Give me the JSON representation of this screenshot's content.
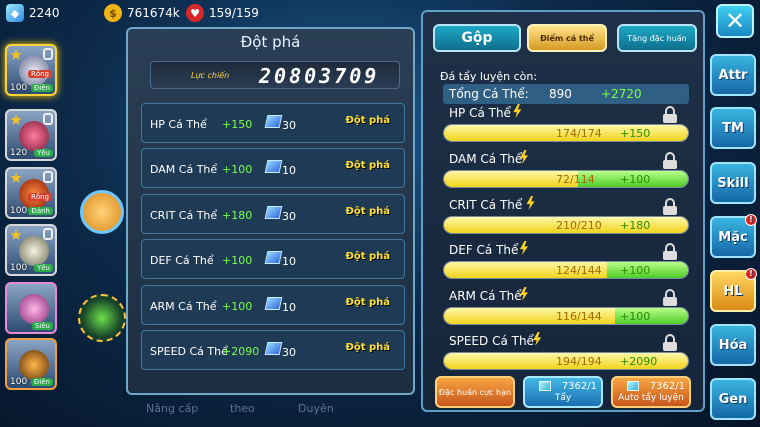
{
  "resources": {
    "gems": "2240",
    "gold": "761674k",
    "energy": "159/159"
  },
  "pets": [
    {
      "level": "100",
      "tag": "Điên",
      "type": "Rồng",
      "selected": true
    },
    {
      "level": "120",
      "tag": "Yếu",
      "type": "",
      "selected": false
    },
    {
      "level": "100",
      "tag": "Đánh",
      "type": "Rồng",
      "selected": false
    },
    {
      "level": "100",
      "tag": "Yếu",
      "type": "",
      "selected": false
    },
    {
      "level": "",
      "tag": "Siêu",
      "type": "",
      "selected": false
    },
    {
      "level": "100",
      "tag": "Điên",
      "type": "",
      "selected": false
    }
  ],
  "breakthrough": {
    "title": "Đột phá",
    "power_label": "Lực chiến",
    "power_value": "20803709",
    "rows": [
      {
        "name": "HP Cá Thể",
        "bonus": "+150",
        "cost": "30",
        "button": "Đột phá"
      },
      {
        "name": "DAM Cá Thể",
        "bonus": "+100",
        "cost": "10",
        "button": "Đột phá"
      },
      {
        "name": "CRIT Cá Thể",
        "bonus": "+180",
        "cost": "30",
        "button": "Đột phá"
      },
      {
        "name": "DEF Cá Thể",
        "bonus": "+100",
        "cost": "10",
        "button": "Đột phá"
      },
      {
        "name": "ARM Cá Thể",
        "bonus": "+100",
        "cost": "10",
        "button": "Đột phá"
      },
      {
        "name": "SPEED Cá Thể",
        "bonus": "+2090",
        "cost": "30",
        "button": "Đột phá"
      }
    ]
  },
  "background_tabs": [
    "Nâng cấp",
    "theo",
    "Duyên"
  ],
  "right_panel": {
    "tabs": [
      "Gộp",
      "Điểm cá thể",
      "Tăng đặc huấn"
    ],
    "remaining_label": "Đá tẩy luyện còn:",
    "total": {
      "label": "Tổng Cá Thể:",
      "value": "890",
      "delta": "+2720"
    },
    "stats": [
      {
        "name": "HP Cá Thể",
        "value": "174/174",
        "bonus": "+150",
        "fill": 1.0,
        "green": 0.0
      },
      {
        "name": "DAM Cá Thể",
        "value": "72/114",
        "bonus": "+100",
        "fill": 0.55,
        "green": 0.45
      },
      {
        "name": "CRIT Cá Thể",
        "value": "210/210",
        "bonus": "+180",
        "fill": 1.0,
        "green": 0.0
      },
      {
        "name": "DEF Cá Thể",
        "value": "124/144",
        "bonus": "+100",
        "fill": 0.67,
        "green": 0.33
      },
      {
        "name": "ARM Cá Thể",
        "value": "116/144",
        "bonus": "+100",
        "fill": 0.7,
        "green": 0.3
      },
      {
        "name": "SPEED Cá Thể",
        "value": "194/194",
        "bonus": "+2090",
        "fill": 1.0,
        "green": 0.0
      }
    ],
    "buttons": {
      "special": "Đặc huấn cực hạn",
      "wash_count": "7362/1",
      "wash_label": "Tẩy",
      "auto_count": "7362/1",
      "auto_label": "Auto tẩy luyện"
    }
  },
  "side_tabs": [
    {
      "label": "Attr",
      "badge": ""
    },
    {
      "label": "TM",
      "badge": ""
    },
    {
      "label": "Skill",
      "badge": ""
    },
    {
      "label": "Mặc",
      "badge": "!"
    },
    {
      "label": "HL",
      "badge": "!"
    },
    {
      "label": "Hóa",
      "badge": ""
    },
    {
      "label": "Gen",
      "badge": ""
    }
  ]
}
